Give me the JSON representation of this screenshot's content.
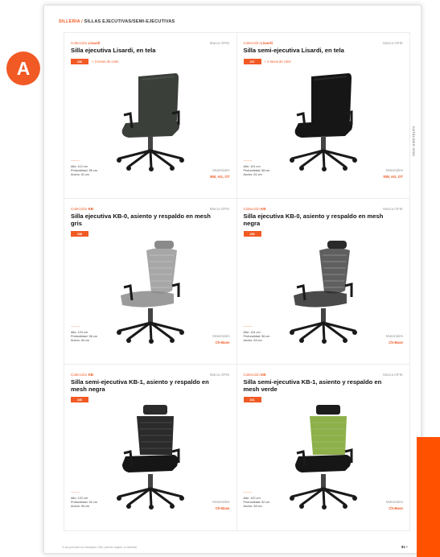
{
  "badge": {
    "letter": "A"
  },
  "breadcrumb": {
    "first": "SILLERIA /",
    "rest": " SILLAS EJECUTIVAS/SEMI-EJECUTIVAS"
  },
  "side_tab": "CATÁLOGO 2020",
  "footer": {
    "note": "*Los precios no incluyen IVA; precio sujeto a cambio",
    "page": "81 •"
  },
  "products": [
    {
      "coleccion_label": "Colección",
      "coleccion_name": "Lisardi",
      "marca": "Marca OFIK",
      "title": "Silla ejecutiva Lisardi, en tela",
      "code": "236",
      "colors_link": "+ 3 tonos de color",
      "chair_color": "#3b3f3a",
      "chair_style": "fabric",
      "spec_dash": "———",
      "specs": [
        "Alto: 112 cm",
        "Profundidad: 55 cm",
        "Ancho: 61 cm"
      ],
      "materiales": "Materiales",
      "mat_value": "NW, AG, OT"
    },
    {
      "coleccion_label": "Colección",
      "coleccion_name": "Lisardi",
      "marca": "Marca OFIK",
      "title": "Silla semi-ejecutiva Lisardi, en tela",
      "code": "237",
      "colors_link": "+ 4 tonos de color",
      "chair_color": "#161616",
      "chair_style": "fabric",
      "spec_dash": "———",
      "specs": [
        "Alto: 101 cm",
        "Profundidad: 58 cm",
        "Ancho: 61 cm"
      ],
      "materiales": "Materiales",
      "mat_value": "NW, AG, OT"
    },
    {
      "coleccion_label": "Colección",
      "coleccion_name": "KB",
      "marca": "Marca OFIK",
      "title": "Silla ejecutiva KB-0, asiento y respaldo en mesh gris",
      "code": "238",
      "colors_link": "",
      "chair_color": "#8a8a8a",
      "chair_style": "mesh",
      "spec_dash": "———",
      "specs": [
        "Alto: 124 cm",
        "Profundidad: 56 cm",
        "Ancho: 63 cm"
      ],
      "materiales": "Materiales",
      "mat_value": "Ch-Base"
    },
    {
      "coleccion_label": "Colección",
      "coleccion_name": "KB",
      "marca": "Marca OFIK",
      "title": "Silla ejecutiva KB-0, asiento y respaldo en mesh negra",
      "code": "239",
      "colors_link": "",
      "chair_color": "#2a2a2a",
      "chair_style": "mesh",
      "spec_dash": "———",
      "specs": [
        "Alto: 124 cm",
        "Profundidad: 56 cm",
        "Ancho: 63 cm"
      ],
      "materiales": "Materiales",
      "mat_value": "Ch-Base"
    },
    {
      "coleccion_label": "Colección",
      "coleccion_name": "KB",
      "marca": "Marca OFIK",
      "title": "Silla semi-ejecutiva KB-1, asiento y respaldo en mesh negra",
      "code": "240",
      "colors_link": "",
      "chair_color": "#2b2b2b",
      "chair_style": "mesh-hr",
      "spec_dash": "———",
      "specs": [
        "Alto: 122 cm",
        "Profundidad: 52 cm",
        "Ancho: 59 cm"
      ],
      "materiales": "Materiales",
      "mat_value": "Ch-Base"
    },
    {
      "coleccion_label": "Colección",
      "coleccion_name": "KB",
      "marca": "Marca OFIK",
      "title": "Silla semi-ejecutiva KB-1, asiento y respaldo en mesh verde",
      "code": "241",
      "colors_link": "",
      "chair_color": "#8db04a",
      "chair_style": "mesh-hr",
      "spec_dash": "———",
      "specs": [
        "Alto: 122 cm",
        "Profundidad: 52 cm",
        "Ancho: 59 cm"
      ],
      "materiales": "Materiales",
      "mat_value": "Ch-Base"
    }
  ]
}
